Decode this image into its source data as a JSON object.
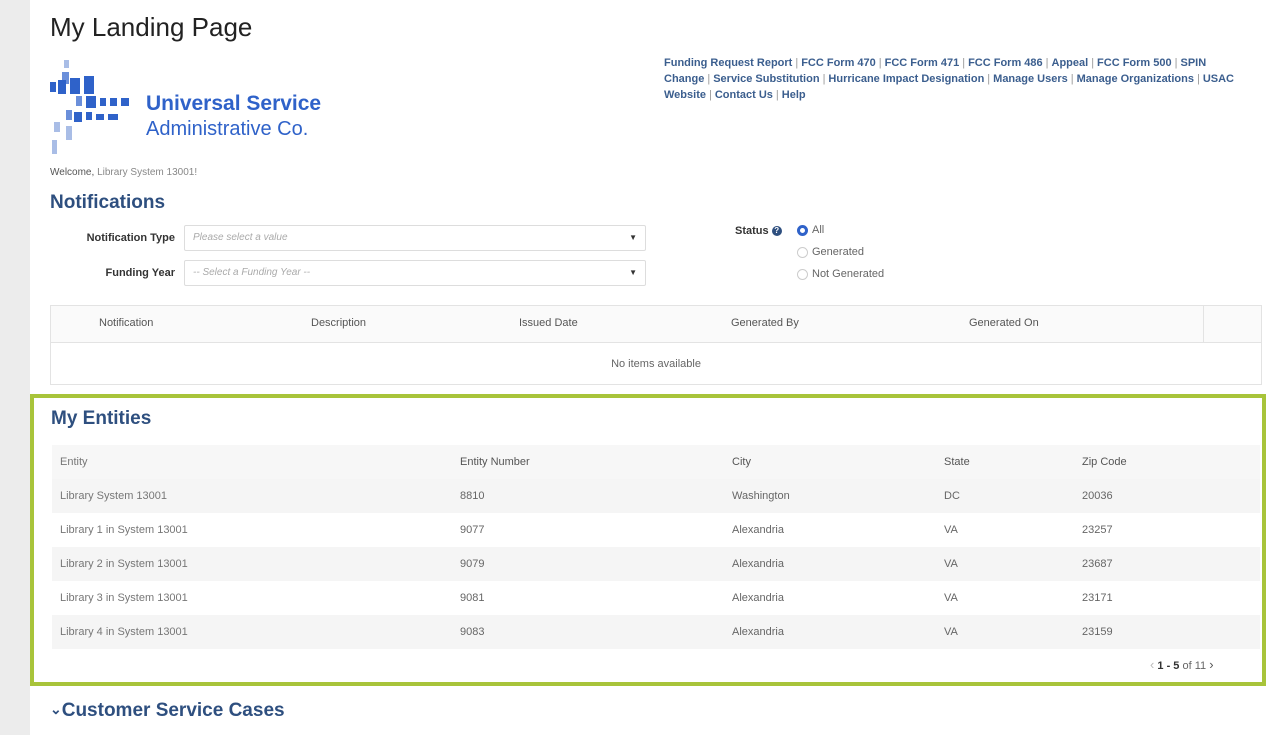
{
  "page": {
    "title": "My Landing Page"
  },
  "logo": {
    "line1": "Universal Service",
    "line2": "Administrative Co."
  },
  "top_links": [
    "Funding Request Report",
    "FCC Form 470",
    "FCC Form 471",
    "FCC Form 486",
    "Appeal",
    "FCC Form 500",
    "SPIN Change",
    "Service Substitution",
    "Hurricane Impact Designation",
    "Manage Users",
    "Manage Organizations",
    "USAC Website",
    "Contact Us",
    "Help"
  ],
  "welcome": {
    "prefix": "Welcome,",
    "user": "Library System 13001!"
  },
  "notifications": {
    "title": "Notifications",
    "type_label": "Notification Type",
    "type_placeholder": "Please select a value",
    "year_label": "Funding Year",
    "year_placeholder": "-- Select a Funding Year --",
    "status_label": "Status",
    "status_options": [
      "All",
      "Generated",
      "Not Generated"
    ],
    "status_selected": "All",
    "columns": [
      "Notification",
      "Description",
      "Issued Date",
      "Generated By",
      "Generated On"
    ],
    "empty_text": "No items available"
  },
  "entities": {
    "title": "My Entities",
    "columns": [
      "Entity",
      "Entity Number",
      "City",
      "State",
      "Zip Code"
    ],
    "rows": [
      [
        "Library System 13001",
        "8810",
        "Washington",
        "DC",
        "20036"
      ],
      [
        "Library 1 in System 13001",
        "9077",
        "Alexandria",
        "VA",
        "23257"
      ],
      [
        "Library 2 in System 13001",
        "9079",
        "Alexandria",
        "VA",
        "23687"
      ],
      [
        "Library 3 in System 13001",
        "9081",
        "Alexandria",
        "VA",
        "23171"
      ],
      [
        "Library 4 in System 13001",
        "9083",
        "Alexandria",
        "VA",
        "23159"
      ]
    ],
    "pager": {
      "range": "1 - 5",
      "of_text": "of 11"
    }
  },
  "customer_service": {
    "title": "Customer Service Cases",
    "icon": "chevron-down-icon"
  },
  "colors": {
    "accent": "#2e4f7f",
    "highlight_border": "#a8c43a",
    "logo_blue": "#2f62c9"
  }
}
